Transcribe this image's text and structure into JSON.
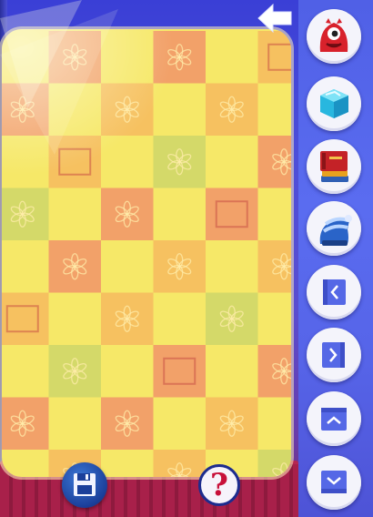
{
  "colors": {
    "board_yellow": "#f6e868",
    "tile_orange": "#f6b45e",
    "tile_red": "#f08a6a",
    "tile_green": "#c8d46a",
    "sidebar_blue": "#5664e8",
    "stage_red": "#a8204a",
    "help_red": "#c8103a"
  },
  "header": {
    "back_icon": "back-arrow-icon"
  },
  "sidebar": {
    "items": [
      {
        "name": "character-tool",
        "icon": "red-monster-icon"
      },
      {
        "name": "block-tool",
        "icon": "ice-block-icon"
      },
      {
        "name": "book-tool",
        "icon": "books-icon"
      },
      {
        "name": "hat-tool",
        "icon": "striped-hat-icon"
      },
      {
        "name": "scroll-left",
        "icon": "arrow-left-icon"
      },
      {
        "name": "scroll-right",
        "icon": "arrow-right-icon"
      },
      {
        "name": "scroll-up",
        "icon": "arrow-up-icon"
      },
      {
        "name": "scroll-down",
        "icon": "arrow-down-icon"
      }
    ]
  },
  "footer": {
    "save_icon": "floppy-disk-icon",
    "help_label": "?"
  }
}
